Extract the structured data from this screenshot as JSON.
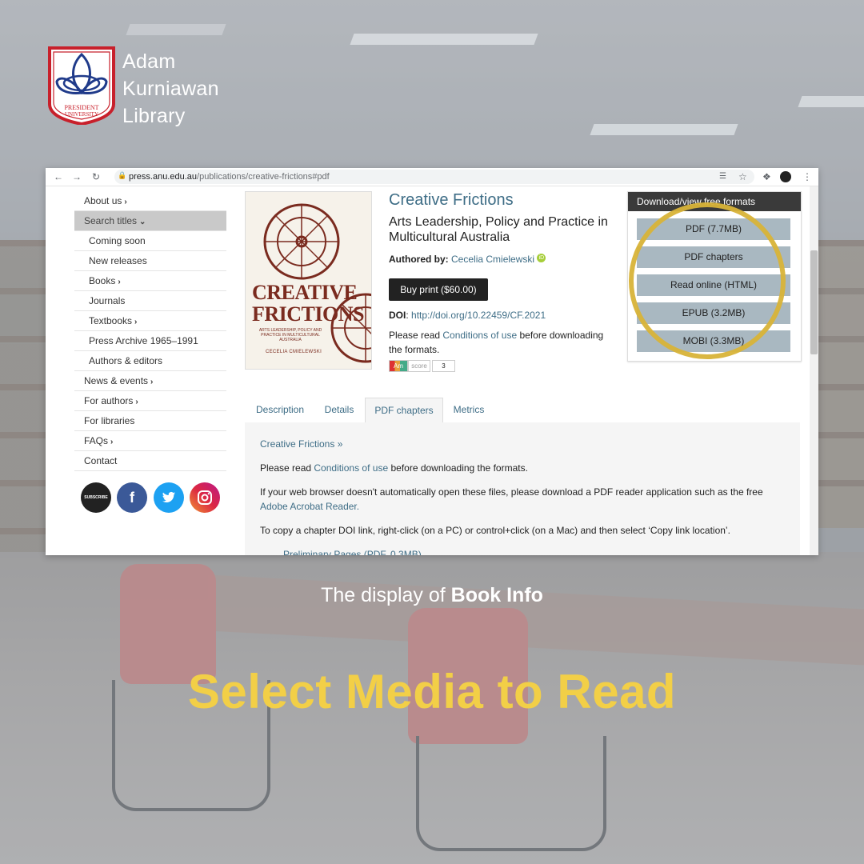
{
  "brand": {
    "logo_text": [
      "PRESIDENT",
      "UNIVERSITY"
    ],
    "name_lines": [
      "Adam",
      "Kurniawan",
      "Library"
    ]
  },
  "browser": {
    "url": "press.anu.edu.au",
    "url_path": "/publications/creative-frictions#pdf"
  },
  "nav": {
    "items": [
      {
        "label": "About us",
        "chevron": "›"
      },
      {
        "label": "Search titles",
        "chevron": "⌄"
      },
      {
        "label": "Coming soon"
      },
      {
        "label": "New releases"
      },
      {
        "label": "Books",
        "chevron": "›"
      },
      {
        "label": "Journals"
      },
      {
        "label": "Textbooks",
        "chevron": "›"
      },
      {
        "label": "Press Archive 1965–1991"
      },
      {
        "label": "Authors & editors"
      },
      {
        "label": "News & events",
        "chevron": "›"
      },
      {
        "label": "For authors",
        "chevron": "›"
      },
      {
        "label": "For libraries"
      },
      {
        "label": "FAQs",
        "chevron": "›"
      },
      {
        "label": "Contact"
      }
    ],
    "social": {
      "subscribe": "SUBSCRIBE",
      "facebook": "f"
    }
  },
  "book": {
    "cover_title": "CREATIVE FRICTIONS",
    "cover_subtitle": "ARTS LEADERSHIP, POLICY AND PRACTICE IN MULTICULTURAL AUSTRALIA",
    "cover_author": "CECELIA CMIELEWSKI",
    "title": "Creative Frictions",
    "subtitle": "Arts Leadership, Policy and Practice in Multicultural Australia",
    "authored_label": "Authored by:",
    "author": "Cecelia Cmielewski",
    "buy_label": "Buy print ($60.00)",
    "doi_label": "DOI",
    "doi": "http://doi.org/10.22459/CF.2021",
    "read_prefix": "Please read",
    "conditions_link": "Conditions of use",
    "read_suffix": "before downloading the formats.",
    "altmetric_label": "Am",
    "altmetric_score_label": "score",
    "altmetric_score": "3"
  },
  "downloads": {
    "heading": "Download/view free formats",
    "buttons": [
      "PDF (7.7MB)",
      "PDF chapters",
      "Read online (HTML)",
      "EPUB (3.2MB)",
      "MOBI (3.3MB)"
    ]
  },
  "tabs": [
    "Description",
    "Details",
    "PDF chapters",
    "Metrics"
  ],
  "content": {
    "breadcrumb": "Creative Frictions »",
    "read_prefix": "Please read",
    "conditions_link": "Conditions of use",
    "read_suffix": "before downloading the formats.",
    "browser_note": "If your web browser doesn't automatically open these files, please download a PDF reader application such as the free",
    "adobe_link": "Adobe Acrobat Reader.",
    "copy_note": "To copy a chapter DOI link, right-click (on a PC) or control+click (on a Mac) and then select ‘Copy link location’.",
    "first_item": "Preliminary Pages (PDF, 0.3MB)"
  },
  "caption": {
    "prefix": "The display of",
    "bold": "Book Info"
  },
  "headline": "Select Media to Read",
  "colors": {
    "headline": "#f2cf47",
    "link": "#3e6d86",
    "ring": "#d8b338"
  }
}
